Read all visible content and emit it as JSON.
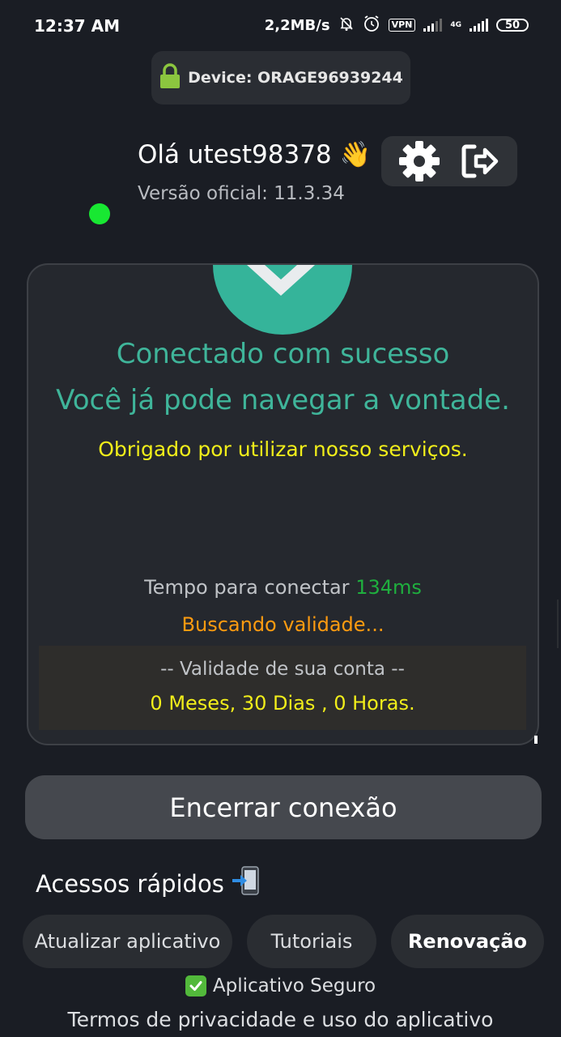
{
  "status_bar": {
    "time": "12:37 AM",
    "speed": "2,2MB/s",
    "vpn": "VPN",
    "network": "4G",
    "battery": "50"
  },
  "device": {
    "label": "Device: ORAGE96939244"
  },
  "header": {
    "greeting": "Olá utest98378 👋",
    "version": "Versão oficial: 11.3.34"
  },
  "status_card": {
    "connected": "Conectado com sucesso",
    "browse": "Você já pode navegar a vontade.",
    "thanks": "Obrigado por utilizar nosso serviços.",
    "time_label": "Tempo para conectar ",
    "time_value": "134ms",
    "searching": "Buscando validade...",
    "validity_title": "-- Validade de sua conta --",
    "validity_value": "0 Meses, 30 Dias , 0 Horas."
  },
  "end_button": "Encerrar conexão",
  "quick_access": {
    "title": "Acessos rápidos",
    "buttons": [
      "Atualizar aplicativo",
      "Tutoriais",
      "Renovação"
    ]
  },
  "footer": {
    "secure": "Aplicativo Seguro",
    "terms": "Termos de privacidade e uso do aplicativo"
  },
  "colors": {
    "background": "#1a1d24",
    "accent_teal": "#35b49a",
    "online_green": "#18e832",
    "highlight_yellow": "#f1ee1a",
    "warning_orange": "#ff9b10"
  }
}
